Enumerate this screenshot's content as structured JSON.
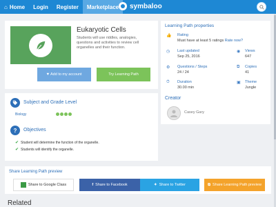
{
  "nav": {
    "home": "Home",
    "login": "Login",
    "register": "Register",
    "marketplace": "Marketplace",
    "brand": "symbaloo"
  },
  "hero": {
    "title": "Eukaryotic Cells",
    "description": "Students will use riddles, analogies, questions and activities to review cell organelles and their function.",
    "add_label": "Add to my account",
    "try_label": "Try Learning Path"
  },
  "subject": {
    "title": "Subject and Grade Level",
    "subject": "Biology",
    "grades": [
      "9",
      "10",
      "11",
      "12"
    ]
  },
  "objectives": {
    "title": "Objectives",
    "items": [
      "Student will determine the function of the organelle.",
      "Students will identify the organelle."
    ]
  },
  "properties": {
    "title": "Learning Path properties",
    "rating_label": "Rating",
    "rating_value": "Must have at least 5 ratings",
    "rate_link": "Rate now?",
    "last_updated_label": "Last updated",
    "last_updated_value": "Sep 25, 2016",
    "views_label": "Views",
    "views_value": "647",
    "questions_label": "Questions / Steps",
    "questions_value": "24 / 24",
    "copies_label": "Copies",
    "copies_value": "41",
    "duration_label": "Duration",
    "duration_value": "30.00 min",
    "theme_label": "Theme",
    "theme_value": "Jungle"
  },
  "creator": {
    "title": "Creator",
    "name": "Casey Gary"
  },
  "share": {
    "title": "Share Learning Path preview",
    "google": "Share to Google Class",
    "facebook": "Share to Facebook",
    "twitter": "Share to Twitter",
    "learning_path": "Share Learning Path preview"
  },
  "related": {
    "title": "Related"
  },
  "colors": {
    "nav": "#1e88d4",
    "accent": "#2d6fb8",
    "green": "#7cc35a",
    "facebook": "#3b62a8",
    "twitter": "#2aa3e3",
    "orange": "#f4a32b"
  }
}
